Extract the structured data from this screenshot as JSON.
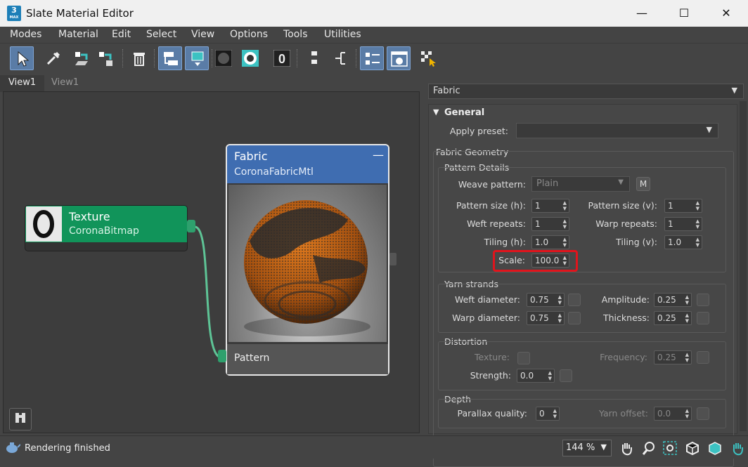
{
  "window": {
    "title": "Slate Material Editor",
    "app_icon_number": "3",
    "app_icon_text": "MAX"
  },
  "window_controls": {
    "minimize": "—",
    "maximize": "☐",
    "close": "✕"
  },
  "menu": [
    "Modes",
    "Material",
    "Edit",
    "Select",
    "View",
    "Options",
    "Tools",
    "Utilities"
  ],
  "views": {
    "tabs": [
      "View1",
      "View1"
    ]
  },
  "nodes": {
    "texture": {
      "name": "Texture",
      "type": "CoronaBitmap"
    },
    "fabric": {
      "name": "Fabric",
      "type": "CoronaFabricMtl",
      "collapse": "—",
      "input_pattern": "Pattern"
    }
  },
  "panel": {
    "material_dropdown": "Fabric",
    "general": {
      "title": "General",
      "apply_preset_label": "Apply preset:",
      "apply_preset_value": ""
    },
    "fabric_geometry": {
      "title": "Fabric Geometry",
      "pattern_details": {
        "title": "Pattern Details",
        "weave_pattern_label": "Weave pattern:",
        "weave_pattern_value": "Plain",
        "map_button": "M",
        "pattern_size_h_label": "Pattern size (h):",
        "pattern_size_h": "1",
        "pattern_size_v_label": "Pattern size (v):",
        "pattern_size_v": "1",
        "weft_repeats_label": "Weft repeats:",
        "weft_repeats": "1",
        "warp_repeats_label": "Warp repeats:",
        "warp_repeats": "1",
        "tiling_h_label": "Tiling (h):",
        "tiling_h": "1.0",
        "tiling_v_label": "Tiling (v):",
        "tiling_v": "1.0",
        "scale_label": "Scale:",
        "scale": "100.0"
      },
      "yarn_strands": {
        "title": "Yarn strands",
        "weft_diameter_label": "Weft diameter:",
        "weft_diameter": "0.75",
        "amplitude_label": "Amplitude:",
        "amplitude": "0.25",
        "warp_diameter_label": "Warp diameter:",
        "warp_diameter": "0.75",
        "thickness_label": "Thickness:",
        "thickness": "0.25"
      },
      "distortion": {
        "title": "Distortion",
        "texture_label": "Texture:",
        "frequency_label": "Frequency:",
        "frequency": "0.25",
        "strength_label": "Strength:",
        "strength": "0.0"
      },
      "depth": {
        "title": "Depth",
        "parallax_label": "Parallax quality:",
        "parallax": "0",
        "yarn_offset_label": "Yarn offset:",
        "yarn_offset": "0.0"
      }
    }
  },
  "status": {
    "text": "Rendering finished",
    "zoom": "144 %"
  },
  "colors": {
    "texture_node": "#11945a",
    "fabric_node": "#3f6db1",
    "wire": "#5ec496",
    "highlight": "#e0141c",
    "active_tool": "#5a7ca6"
  }
}
